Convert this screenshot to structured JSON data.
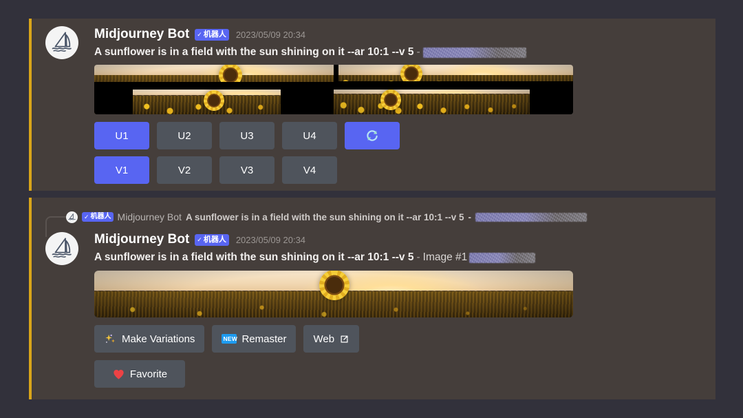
{
  "theme": {
    "page_background": "#32313b",
    "message_background": "#453e3b",
    "accent_bar": "#d9a519",
    "brand_blurple": "#5865f2",
    "button_secondary": "#4f545c",
    "text_primary": "#f2f0ef",
    "text_muted": "#9b9693"
  },
  "messages": [
    {
      "author": "Midjourney Bot",
      "bot_badge": "机器人",
      "bot_badge_check": "✓",
      "timestamp": "2023/05/09 20:34",
      "prompt": "A sunflower is in a field with the sun shining on it --ar 10:1 --v 5",
      "separator": "-",
      "suffix": "",
      "redacted_username": true,
      "avatar_icon": "midjourney-sailboat-icon",
      "image_alt": "2x2 grid of ultra-wide sunflower field images at sunset",
      "upscale_buttons": [
        {
          "label": "U1",
          "style": "primary"
        },
        {
          "label": "U2",
          "style": "secondary"
        },
        {
          "label": "U3",
          "style": "secondary"
        },
        {
          "label": "U4",
          "style": "secondary"
        }
      ],
      "reroll_button": {
        "label": "",
        "icon": "refresh-icon",
        "style": "primary"
      },
      "variation_buttons": [
        {
          "label": "V1",
          "style": "primary"
        },
        {
          "label": "V2",
          "style": "secondary"
        },
        {
          "label": "V3",
          "style": "secondary"
        },
        {
          "label": "V4",
          "style": "secondary"
        }
      ]
    },
    {
      "reply_reference": {
        "author": "Midjourney Bot",
        "bot_badge": "机器人",
        "bot_badge_check": "✓",
        "text": "A sunflower is in a field with the sun shining on it --ar 10:1 --v 5",
        "separator": "-",
        "redacted_username": true,
        "avatar_icon": "midjourney-sailboat-icon"
      },
      "author": "Midjourney Bot",
      "bot_badge": "机器人",
      "bot_badge_check": "✓",
      "timestamp": "2023/05/09 20:34",
      "prompt": "A sunflower is in a field with the sun shining on it --ar 10:1 --v 5",
      "separator": "-",
      "suffix": "Image #1",
      "redacted_username": true,
      "avatar_icon": "midjourney-sailboat-icon",
      "image_alt": "Ultra-wide upscaled sunflower field image at sunset",
      "action_buttons": [
        {
          "label": "Make Variations",
          "icon": "sparkles-icon",
          "style": "secondary"
        },
        {
          "label": "Remaster",
          "icon": "new-badge-icon",
          "style": "secondary"
        },
        {
          "label": "Web",
          "icon": "external-link-icon",
          "style": "secondary"
        }
      ],
      "favorite_button": {
        "label": "Favorite",
        "icon": "heart-icon",
        "style": "secondary"
      }
    }
  ]
}
